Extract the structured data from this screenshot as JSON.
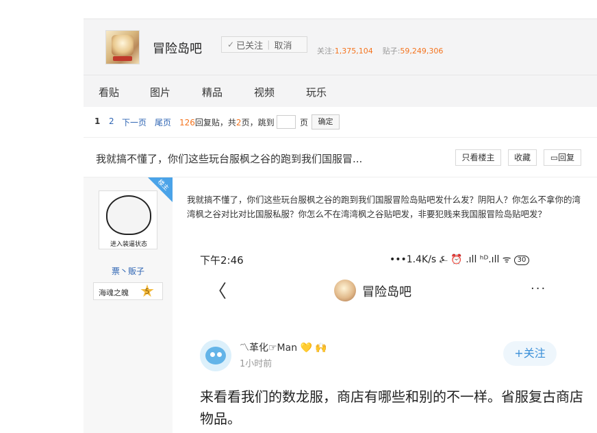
{
  "forum": {
    "name": "冒险岛吧",
    "follow_check": "✓",
    "followed_label": "已关注",
    "cancel_label": "取消",
    "stats_follow_label": "关注:",
    "stats_follow_value": "1,375,104",
    "stats_posts_label": "贴子:",
    "stats_posts_value": "59,249,306"
  },
  "tabs": [
    "看贴",
    "图片",
    "精品",
    "视频",
    "玩乐"
  ],
  "pager": {
    "current": "1",
    "page2": "2",
    "next": "下一页",
    "last": "尾页",
    "reply_count": "126",
    "reply_text": "回复贴，共",
    "total_pages": "2",
    "pages_text": "页，跳到",
    "page_suffix": "页",
    "confirm": "确定"
  },
  "thread": {
    "title": "我就搞不懂了，你们这些玩台服枫之谷的跑到我们国服冒...",
    "only_op": "只看楼主",
    "favorite": "收藏",
    "reply_icon": "▭",
    "reply": "回复"
  },
  "post": {
    "op_badge": "楼主",
    "avatar_caption": "进入装逼状态",
    "author": "票丶贩子",
    "rank_name": "海魂之魄",
    "rank_level": "5",
    "body": "我就搞不懂了，你们这些玩台服枫之谷的跑到我们国服冒险岛贴吧发什么发？阴阳人？你怎么不拿你的湾湾枫之谷对比对比国服私服？你怎么不在湾湾枫之谷贴吧发，非要犯贱来我国服冒险岛贴吧发？"
  },
  "screenshot": {
    "time": "下午2:46",
    "status": "•••1.4K/s ⍼ ⏰ .ıll ʰᴰ.ıll ᯤ",
    "battery": "30",
    "back_icon": "〈",
    "bar_name": "冒险岛吧",
    "more_icon": "···",
    "user_name": "〽革化☞Man 💛 🙌",
    "user_time": "1小时前",
    "follow": "+关注",
    "content": "来看看我们的数龙服，商店有哪些和别的不一样。省服复古商店物品。"
  }
}
